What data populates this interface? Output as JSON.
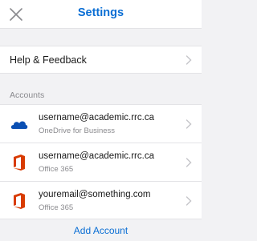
{
  "header": {
    "title": "Settings",
    "close_icon": "close-icon"
  },
  "help": {
    "label": "Help & Feedback"
  },
  "accounts_section": {
    "label": "Accounts"
  },
  "accounts": [
    {
      "email": "username@academic.rrc.ca",
      "service": "OneDrive for Business",
      "icon": "onedrive-icon"
    },
    {
      "email": "username@academic.rrc.ca",
      "service": "Office 365",
      "icon": "office365-icon"
    },
    {
      "email": "youremail@something.com",
      "service": "Office 365",
      "icon": "office365-icon"
    }
  ],
  "add_account": {
    "label": "Add Account"
  },
  "colors": {
    "accent": "#0a6ed4",
    "onedrive": "#0a4fb3",
    "office": "#d83b01"
  }
}
